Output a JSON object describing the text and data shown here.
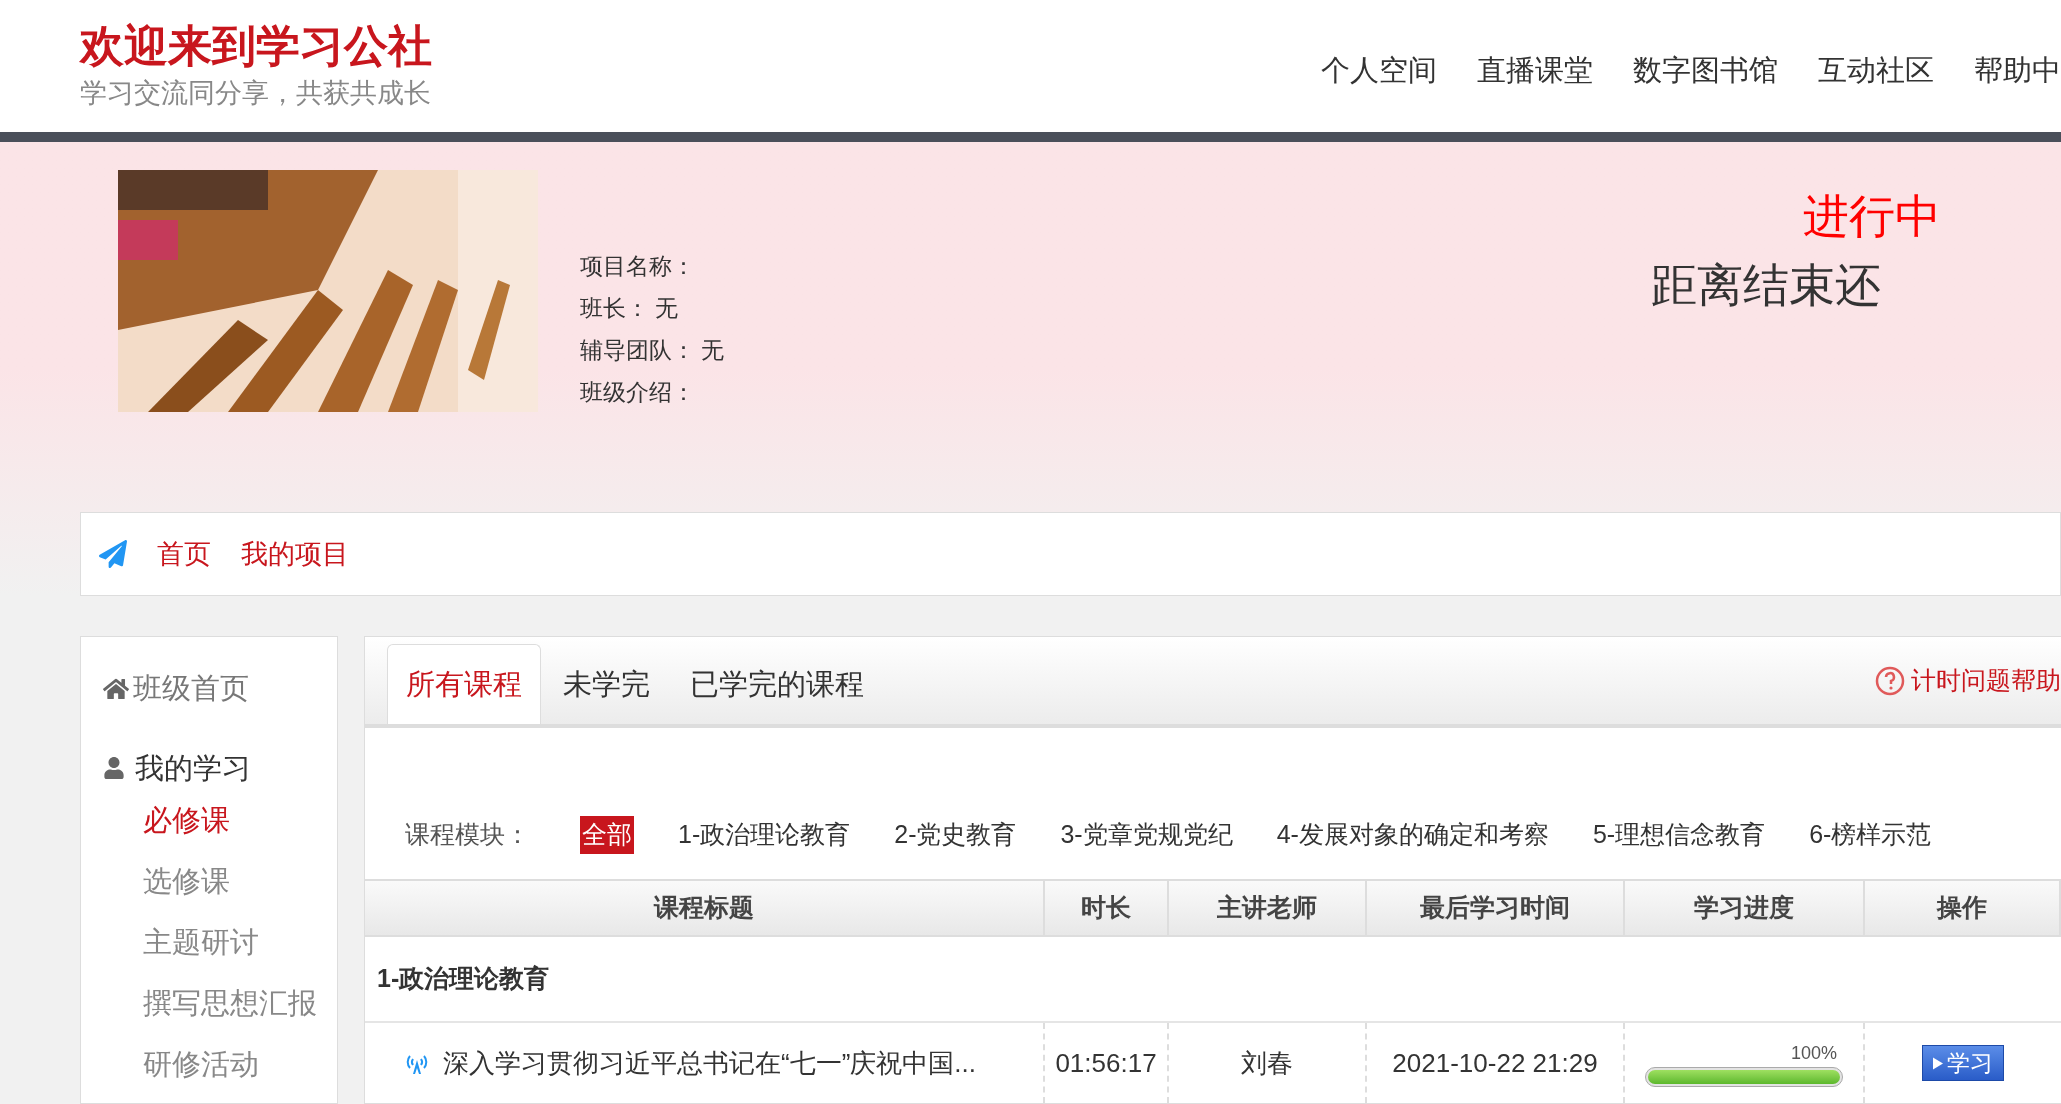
{
  "site": {
    "title": "欢迎来到学习公社",
    "slogan": "学习交流同分享，共获共成长"
  },
  "nav": [
    {
      "label": "个人空间"
    },
    {
      "label": "直播课堂"
    },
    {
      "label": "数字图书馆"
    },
    {
      "label": "互动社区"
    },
    {
      "label": "帮助中"
    }
  ],
  "project": {
    "fields": [
      {
        "label": "项目名称："
      },
      {
        "label": "班长：",
        "value": "无"
      },
      {
        "label": "辅导团队：",
        "value": "无"
      },
      {
        "label": "班级介绍："
      }
    ],
    "status": "进行中",
    "countdown": "距离结束还"
  },
  "breadcrumb": [
    {
      "label": "首页"
    },
    {
      "label": "我的项目"
    }
  ],
  "sidebar": {
    "sections": [
      {
        "title": "班级首页",
        "kind": "home"
      },
      {
        "title": "我的学习",
        "kind": "group",
        "children": [
          {
            "label": "必修课",
            "selected": true
          },
          {
            "label": "选修课",
            "selected": false
          },
          {
            "label": "主题研讨",
            "selected": false
          },
          {
            "label": "撰写思想汇报",
            "selected": false
          },
          {
            "label": "研修活动",
            "selected": false
          }
        ]
      }
    ]
  },
  "tabs": [
    {
      "label": "所有课程",
      "selected": true
    },
    {
      "label": "未学完",
      "selected": false
    },
    {
      "label": "已学完的课程",
      "selected": false
    }
  ],
  "help_link": "计时问题帮助",
  "modules": {
    "label": "课程模块：",
    "items": [
      {
        "label": "全部",
        "selected": true
      },
      {
        "label": "1-政治理论教育",
        "selected": false
      },
      {
        "label": "2-党史教育",
        "selected": false
      },
      {
        "label": "3-党章党规党纪",
        "selected": false
      },
      {
        "label": "4-发展对象的确定和考察",
        "selected": false
      },
      {
        "label": "5-理想信念教育",
        "selected": false
      },
      {
        "label": "6-榜样示范",
        "selected": false
      }
    ]
  },
  "table": {
    "columns": [
      "课程标题",
      "时长",
      "主讲老师",
      "最后学习时间",
      "学习进度",
      "操作"
    ],
    "groups": [
      {
        "title": "1-政治理论教育",
        "rows": [
          {
            "title": "深入学习贯彻习近平总书记在“七一”庆祝中国...",
            "duration": "01:56:17",
            "teacher": "刘春",
            "last_time": "2021-10-22 21:29",
            "progress_text": "100%",
            "level": 1.0,
            "action": "学习"
          }
        ]
      }
    ]
  }
}
